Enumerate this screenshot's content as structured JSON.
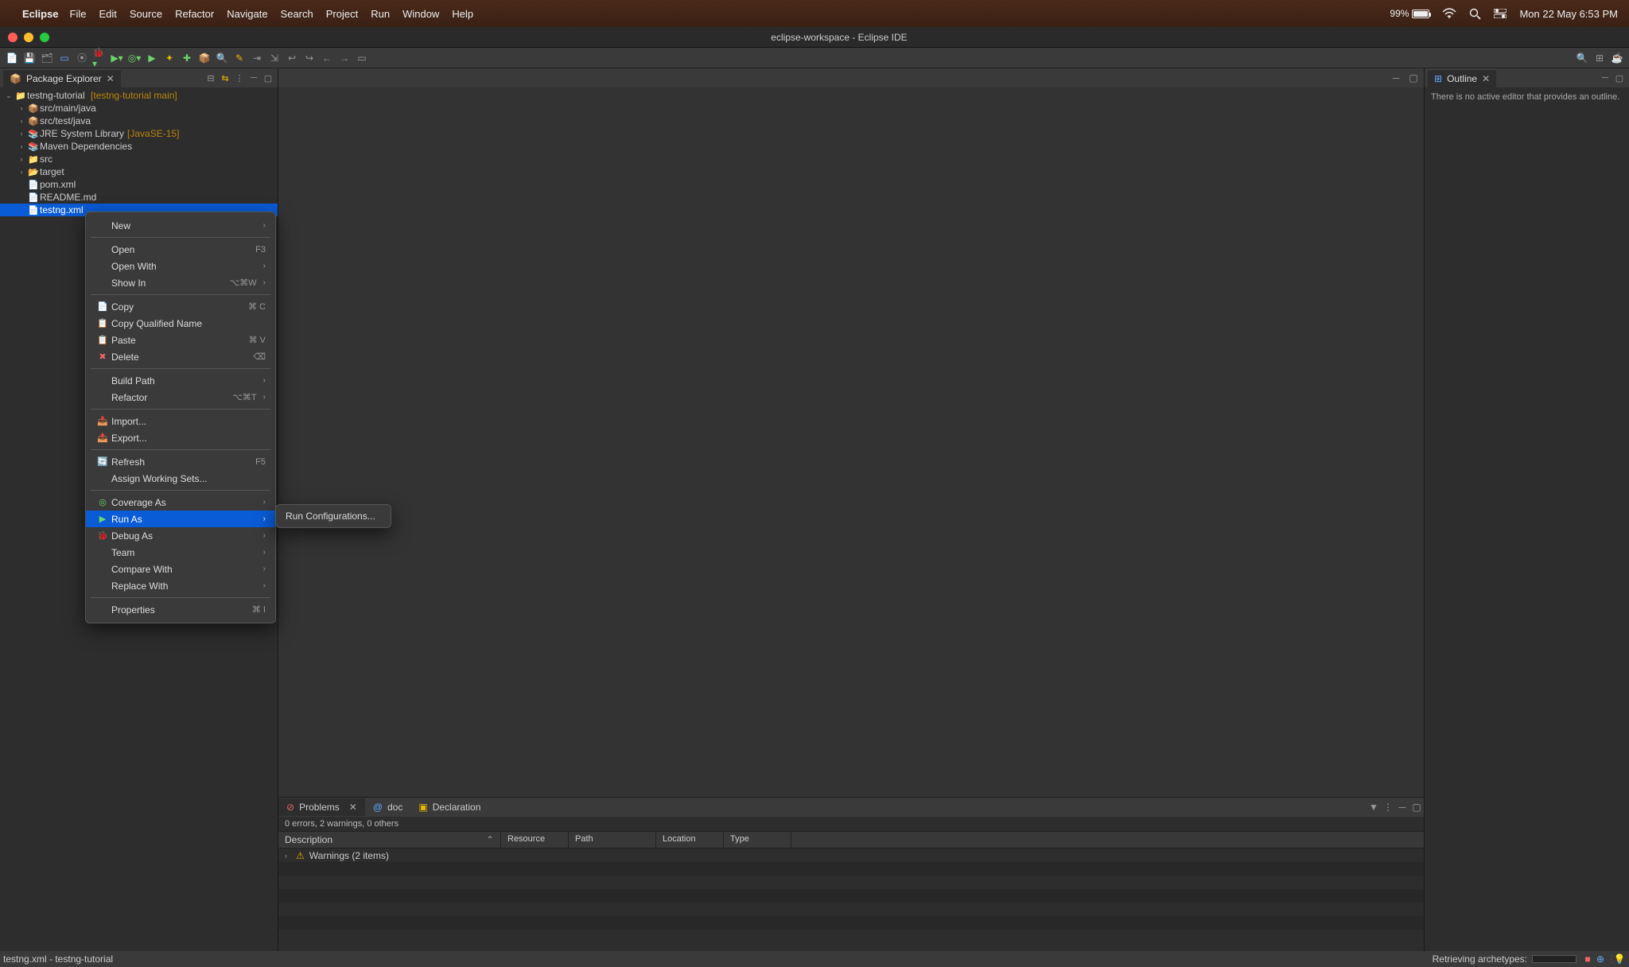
{
  "macos": {
    "app": "Eclipse",
    "menus": [
      "File",
      "Edit",
      "Source",
      "Refactor",
      "Navigate",
      "Search",
      "Project",
      "Run",
      "Window",
      "Help"
    ],
    "battery": "99%",
    "datetime": "Mon 22 May  6:53 PM"
  },
  "window": {
    "title": "eclipse-workspace - Eclipse IDE"
  },
  "explorer": {
    "tab": "Package Explorer",
    "root": "testng-tutorial",
    "root_annotation": "[testng-tutorial main]",
    "nodes": [
      {
        "label": "src/main/java",
        "indent": 1,
        "expand": ">",
        "ico": "📦"
      },
      {
        "label": "src/test/java",
        "indent": 1,
        "expand": ">",
        "ico": "📦"
      },
      {
        "label": "JRE System Library",
        "extra": "[JavaSE-15]",
        "indent": 1,
        "expand": ">",
        "ico": "📚"
      },
      {
        "label": "Maven Dependencies",
        "indent": 1,
        "expand": ">",
        "ico": "📚"
      },
      {
        "label": "src",
        "indent": 1,
        "expand": ">",
        "ico": "📁"
      },
      {
        "label": "target",
        "indent": 1,
        "expand": ">",
        "ico": "📂"
      },
      {
        "label": "pom.xml",
        "indent": 1,
        "expand": "",
        "ico": "📄"
      },
      {
        "label": "README.md",
        "indent": 1,
        "expand": "",
        "ico": "📄"
      },
      {
        "label": "testng.xml",
        "indent": 1,
        "expand": "",
        "ico": "📄",
        "selected": true
      }
    ]
  },
  "outline": {
    "tab": "Outline",
    "empty": "There is no active editor that provides an outline."
  },
  "bottom": {
    "tabs": {
      "problems": "Problems",
      "javadoc": "doc",
      "decl": "Declaration"
    },
    "summary": "0 errors, 2 warnings, 0 others",
    "cols": {
      "desc": "Description",
      "res": "Resource",
      "path": "Path",
      "loc": "Location",
      "type": "Type"
    },
    "warning_row": "Warnings (2 items)"
  },
  "context_menu": {
    "new": "New",
    "open": "Open",
    "open_sc": "F3",
    "open_with": "Open With",
    "show_in": "Show In",
    "show_in_sc": "⌥⌘W",
    "copy": "Copy",
    "copy_sc": "⌘ C",
    "copy_q": "Copy Qualified Name",
    "paste": "Paste",
    "paste_sc": "⌘ V",
    "delete": "Delete",
    "delete_sc": "⌫",
    "build_path": "Build Path",
    "refactor": "Refactor",
    "refactor_sc": "⌥⌘T",
    "import": "Import...",
    "export": "Export...",
    "refresh": "Refresh",
    "refresh_sc": "F5",
    "assign_ws": "Assign Working Sets...",
    "coverage": "Coverage As",
    "run_as": "Run As",
    "debug_as": "Debug As",
    "team": "Team",
    "compare": "Compare With",
    "replace": "Replace With",
    "properties": "Properties",
    "properties_sc": "⌘ I"
  },
  "submenu": {
    "run_conf": "Run Configurations..."
  },
  "status": {
    "left": "testng.xml - testng-tutorial",
    "right": "Retrieving archetypes:"
  }
}
